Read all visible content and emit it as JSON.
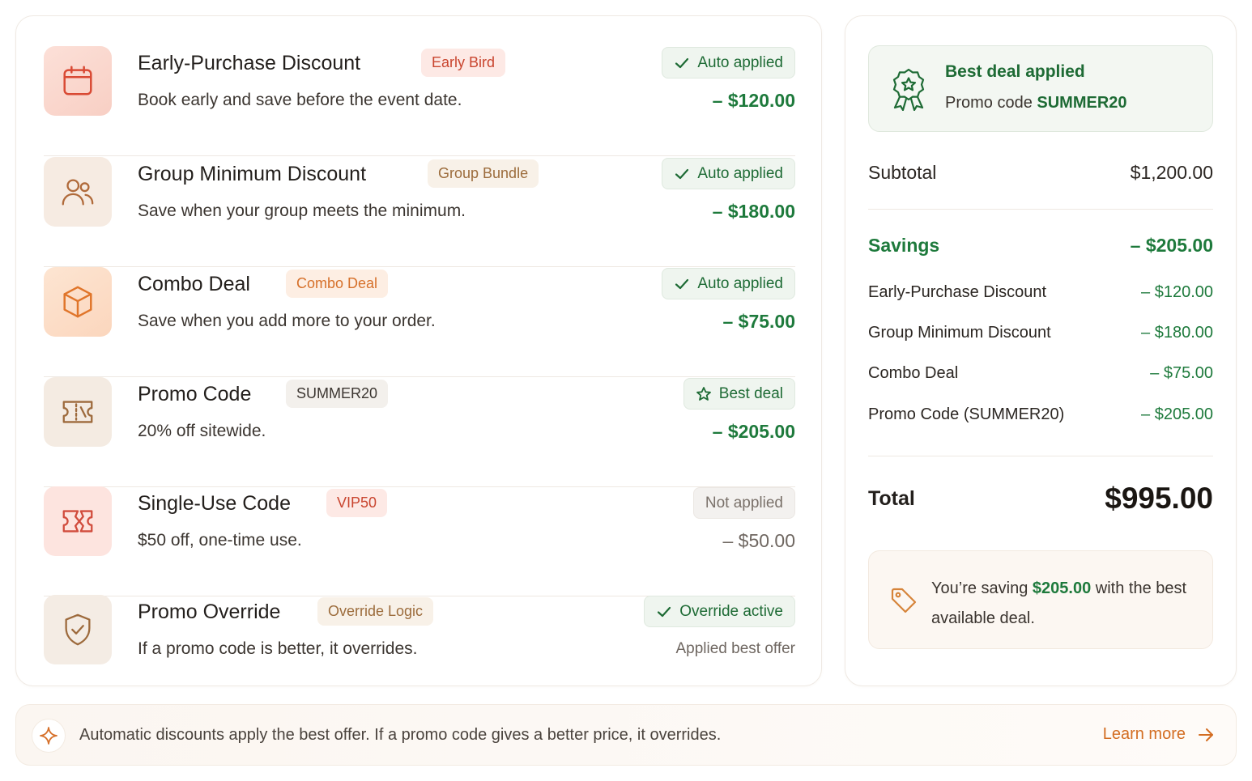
{
  "discounts": [
    {
      "title": "Early-Purchase Discount",
      "tag": "Early Bird",
      "description": "Book early and save before the event date.",
      "status": "Auto applied",
      "amount": "– $120.00",
      "icon": "calendar-icon"
    },
    {
      "title": "Group Minimum Discount",
      "tag": "Group Bundle",
      "description": "Save when your group meets the minimum.",
      "status": "Auto applied",
      "amount": "– $180.00",
      "icon": "users-icon"
    },
    {
      "title": "Combo Deal",
      "tag": "Combo Deal",
      "description": "Save when you add more to your order.",
      "status": "Auto applied",
      "amount": "– $75.00",
      "icon": "box-icon"
    },
    {
      "title": "Promo Code",
      "tag": "SUMMER20",
      "description": "20% off sitewide.",
      "status": "Best deal",
      "amount": "– $205.00",
      "icon": "ticket-icon"
    },
    {
      "title": "Single-Use Code",
      "tag": "VIP50",
      "description": "$50 off, one-time use.",
      "status": "Not applied",
      "amount": "– $50.00",
      "icon": "torn-ticket-icon"
    },
    {
      "title": "Promo Override",
      "tag": "Override Logic",
      "description": "If a promo code is better, it overrides.",
      "status": "Override active",
      "amount": "Applied best offer",
      "icon": "shield-check-icon"
    }
  ],
  "summary": {
    "best_deal_title": "Best deal applied",
    "best_deal_prefix": "Promo code ",
    "best_deal_code": "SUMMER20",
    "subtotal_label": "Subtotal",
    "subtotal_value": "$1,200.00",
    "savings_label": "Savings",
    "savings_value": "– $205.00",
    "lines": [
      {
        "label": "Early-Purchase Discount",
        "value": "– $120.00"
      },
      {
        "label": "Group Minimum Discount",
        "value": "– $180.00"
      },
      {
        "label": "Combo Deal",
        "value": "– $75.00"
      },
      {
        "label": "Promo Code (SUMMER20)",
        "value": "– $205.00"
      }
    ],
    "total_label": "Total",
    "total_value": "$995.00",
    "tip_prefix": "You’re saving ",
    "tip_amount": "$205.00",
    "tip_suffix": " with the best available deal."
  },
  "footer": {
    "text": "Automatic discounts apply the best offer. If a promo code gives a better price, it overrides.",
    "link": "Learn more"
  },
  "colors": {
    "green": "#1e7a3c",
    "orange": "#d36d22",
    "red_tag": "#c9452f"
  }
}
